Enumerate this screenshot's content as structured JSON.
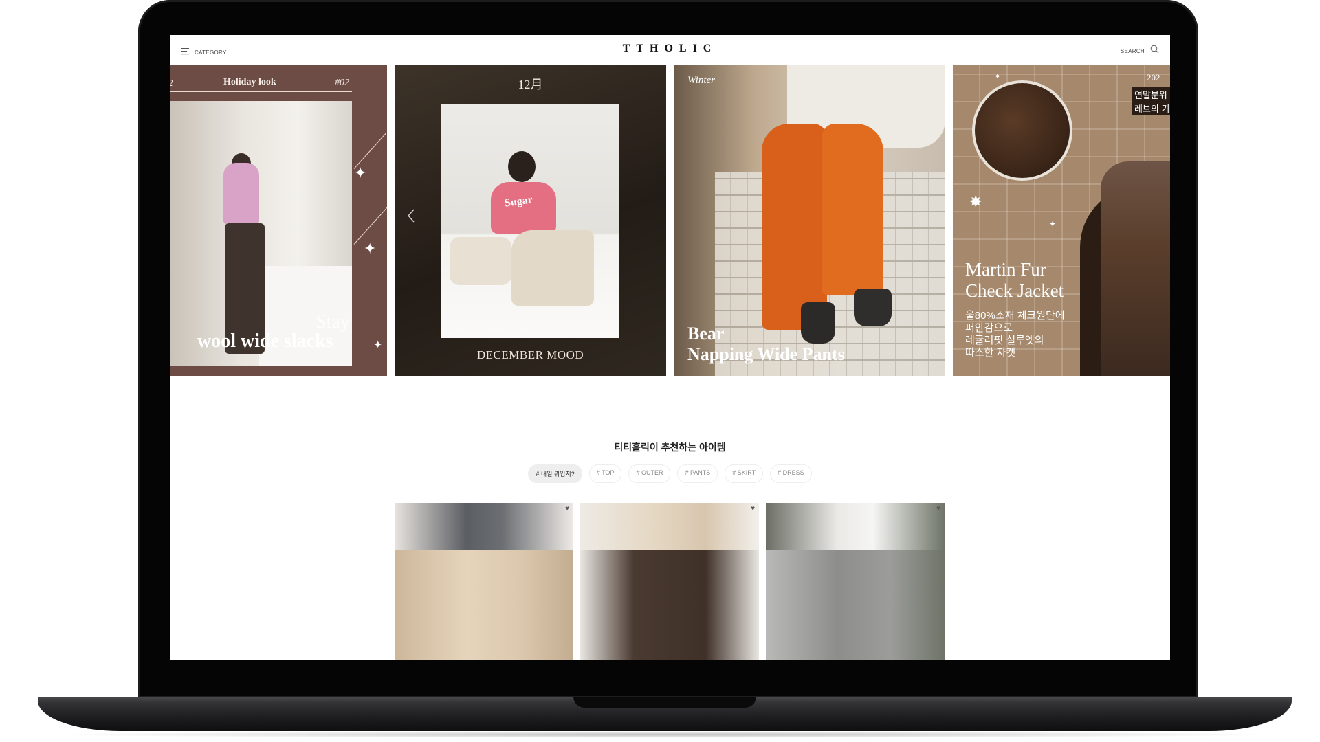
{
  "header": {
    "category_label": "CATEGORY",
    "logo": "TTHOLIC",
    "search_label": "SEARCH"
  },
  "banner": {
    "slide1": {
      "number_left": "2",
      "title": "Holiday look",
      "number": "#02",
      "copy_line1": "Stay",
      "copy_line2": "wool wide slacks"
    },
    "slide2": {
      "month": "12月",
      "print": "Sugar",
      "caption": "DECEMBER MOOD"
    },
    "slide3": {
      "tag": "Winter",
      "copy_line1": "Bear",
      "copy_line2": "Napping Wide Pants"
    },
    "slide4": {
      "year": "202",
      "kr_tag1": "연말분위",
      "kr_tag2": "레브의 기",
      "copy_line1": "Martin Fur",
      "copy_line2": "Check Jacket",
      "desc": [
        "울80%소재 체크원단에",
        "퍼안감으로",
        "레귤러핏 실루엣의",
        "따스한 자켓"
      ]
    }
  },
  "recommend": {
    "title": "티티홀릭이 추천하는 아이템",
    "tags": [
      "# 내일 뭐입지?",
      "# TOP",
      "# OUTER",
      "# PANTS",
      "# SKIRT",
      "# DRESS"
    ]
  },
  "icons": {
    "menu": "hamburger-menu-icon",
    "search": "magnifier-icon",
    "prev": "chevron-left-icon",
    "wish": "heart-icon"
  },
  "colors": {
    "active_tag_bg": "#eeeeee",
    "slide1_bg": "#6e4c46",
    "slide4_bg": "#a6896d"
  }
}
